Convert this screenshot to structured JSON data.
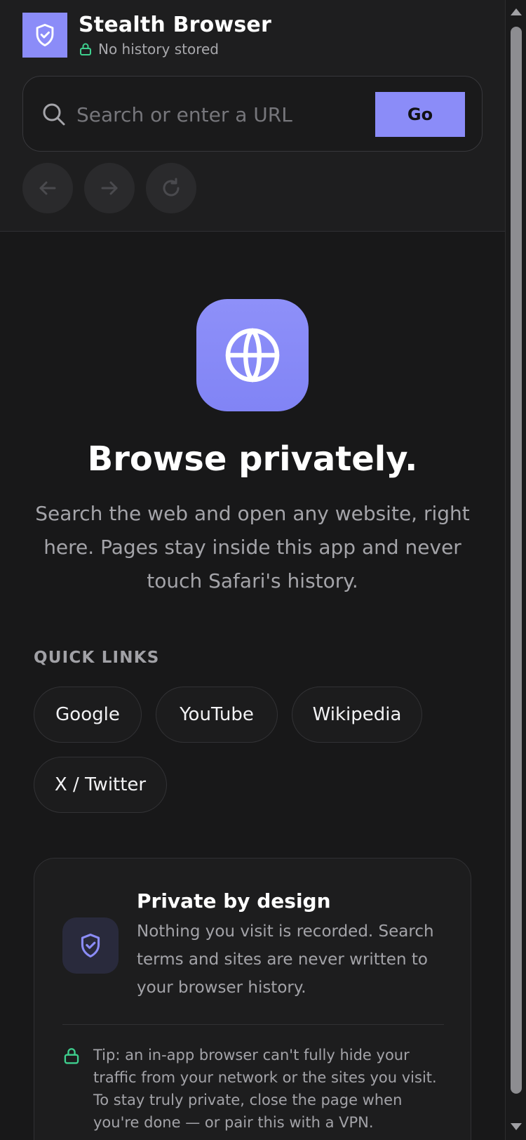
{
  "app": {
    "title": "Stealth Browser",
    "status": "No history stored"
  },
  "search": {
    "placeholder": "Search or enter a URL",
    "value": "",
    "go_label": "Go"
  },
  "nav": {
    "back_icon": "arrow-left-icon",
    "forward_icon": "arrow-right-icon",
    "reload_icon": "reload-icon"
  },
  "hero": {
    "icon": "globe-icon",
    "title": "Browse privately.",
    "description": "Search the web and open any website, right here. Pages stay inside this app and never touch Safari's history."
  },
  "quick_links": {
    "label": "QUICK LINKS",
    "items": [
      {
        "label": "Google"
      },
      {
        "label": "YouTube"
      },
      {
        "label": "Wikipedia"
      },
      {
        "label": "X / Twitter"
      }
    ]
  },
  "private_card": {
    "icon": "shield-check-icon",
    "title": "Private by design",
    "text": "Nothing you visit is recorded. Search terms and sites are never written to your browser history.",
    "tip": "Tip: an in-app browser can't fully hide your traffic from your network or the sites you visit. To stay truly private, close the page when you're done — or pair this with a VPN."
  },
  "colors": {
    "accent": "#8b8cf8",
    "secure_green": "#3ecf8e",
    "background": "#181819"
  }
}
